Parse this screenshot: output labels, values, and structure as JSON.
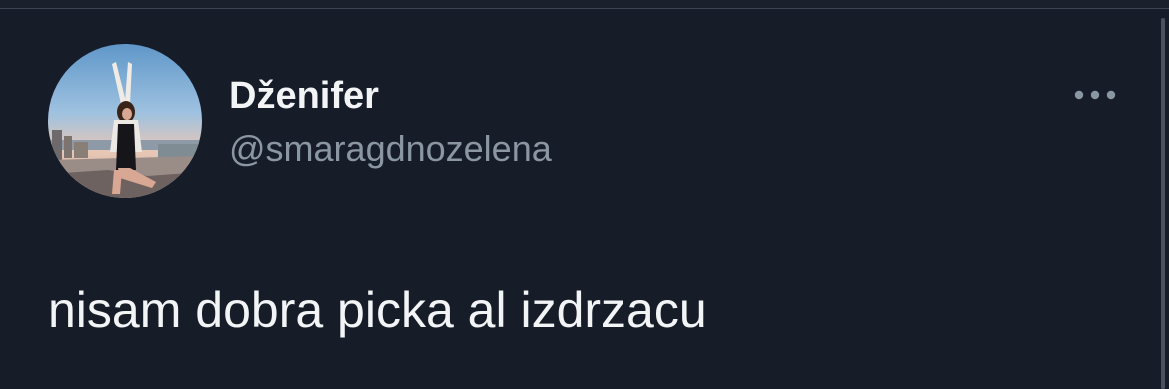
{
  "tweet": {
    "display_name": "Dženifer",
    "handle": "@smaragdnozelena",
    "text": "nisam dobra picka al izdrzacu"
  },
  "icons": {
    "more": "more-horizontal-icon",
    "avatar": "profile-photo"
  },
  "colors": {
    "background": "#161d29",
    "primary_text": "#f2f4f6",
    "secondary_text": "#8b96a3"
  }
}
